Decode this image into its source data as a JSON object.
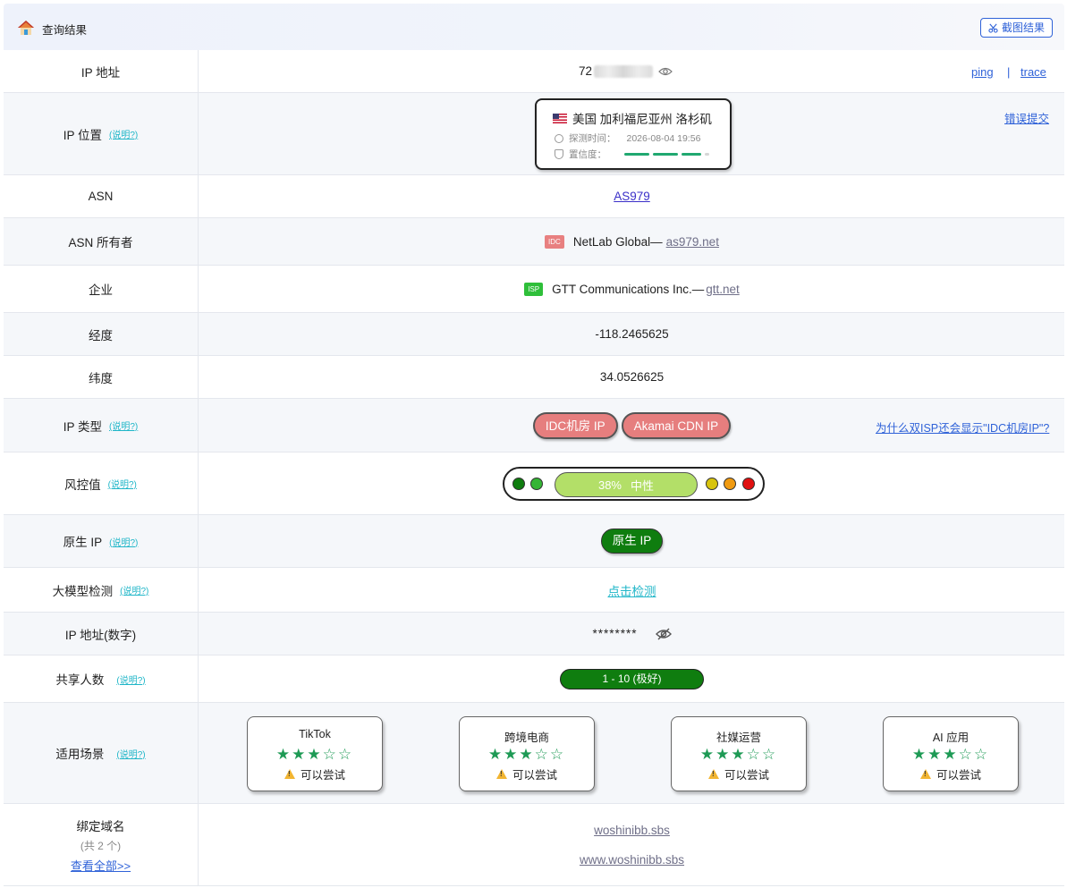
{
  "header": {
    "title": "查询结果",
    "screenshot_label": "截图结果"
  },
  "links": {
    "ping": "ping",
    "separator": "|",
    "trace": "trace",
    "report_error": "错误提交",
    "why_idc": "为什么双ISP还会显示\"IDC机房IP\"?"
  },
  "explain_label": "(说明?)",
  "rows": {
    "ip": {
      "label": "IP 地址",
      "value_prefix": "72"
    },
    "location": {
      "label": "IP 位置",
      "place": "美国 加利福尼亚州 洛杉矶",
      "detect_label": "探测时间：",
      "detect_time": "2026-08-04 19:56",
      "confidence_label": "置信度："
    },
    "asn": {
      "label": "ASN",
      "value": "AS979"
    },
    "asn_owner": {
      "label": "ASN 所有者",
      "badge": "IDC",
      "name": "NetLab Global—",
      "domain": "as979.net"
    },
    "company": {
      "label": "企业",
      "badge": "ISP",
      "name": "GTT Communications Inc.—",
      "domain": "gtt.net"
    },
    "longitude": {
      "label": "经度",
      "value": "-118.2465625"
    },
    "latitude": {
      "label": "纬度",
      "value": "34.0526625"
    },
    "ip_type": {
      "label": "IP 类型",
      "tags": [
        "IDC机房 IP",
        "Akamai CDN IP"
      ]
    },
    "risk": {
      "label": "风控值",
      "score": "38%",
      "level": "中性",
      "value_fraction": 0.38
    },
    "native": {
      "label": "原生 IP",
      "value": "原生 IP"
    },
    "llm": {
      "label": "大模型检测",
      "action": "点击检测"
    },
    "ip_numeric": {
      "label": "IP 地址(数字)",
      "value": "********"
    },
    "shared": {
      "label": "共享人数",
      "value": "1 - 10 (极好)"
    },
    "scenes": {
      "label": "适用场景",
      "items": [
        {
          "name": "TikTok",
          "rating": 3,
          "max": 5,
          "status": "可以尝试"
        },
        {
          "name": "跨境电商",
          "rating": 3,
          "max": 5,
          "status": "可以尝试"
        },
        {
          "name": "社媒运营",
          "rating": 3,
          "max": 5,
          "status": "可以尝试"
        },
        {
          "name": "AI 应用",
          "rating": 3,
          "max": 5,
          "status": "可以尝试"
        }
      ]
    },
    "domains": {
      "label": "绑定域名",
      "count": "(共 2 个)",
      "view_all": "查看全部>>",
      "items": [
        "woshinibb.sbs",
        "www.woshinibb.sbs"
      ]
    }
  },
  "colors": {
    "accent": "#2f62d8",
    "explain": "#1fb6c8",
    "idc_badge": "#e88080",
    "isp_badge": "#2fbf3a",
    "pill_red": "#e67e7e",
    "native_green": "#0f7d0f",
    "risk_bar": "#b3df68",
    "star_green": "#1e9a55"
  }
}
